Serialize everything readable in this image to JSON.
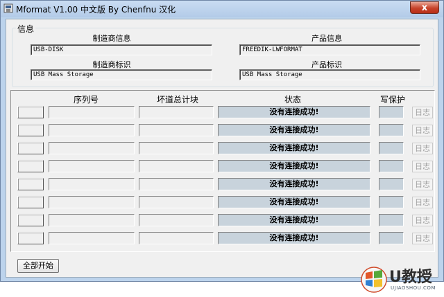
{
  "window": {
    "title": "Mformat V1.00 中文版 By Chenfnu 汉化",
    "close_label": "x"
  },
  "info": {
    "group_title": "信息",
    "manufacturer_info_label": "制造商信息",
    "manufacturer_info_value": "USB-DISK",
    "product_info_label": "产品信息",
    "product_info_value": "FREEDIK-LWFORMAT",
    "manufacturer_id_label": "制造商标识",
    "manufacturer_id_value": "USB Mass Storage",
    "product_id_label": "产品标识",
    "product_id_value": "USB Mass Storage"
  },
  "table": {
    "headers": {
      "serial": "序列号",
      "bad_blocks": "坏道总计块",
      "status": "状态",
      "write_protect": "写保护"
    },
    "rows": [
      {
        "status": "没有连接成功!",
        "log": "日志"
      },
      {
        "status": "没有连接成功!",
        "log": "日志"
      },
      {
        "status": "没有连接成功!",
        "log": "日志"
      },
      {
        "status": "没有连接成功!",
        "log": "日志"
      },
      {
        "status": "没有连接成功!",
        "log": "日志"
      },
      {
        "status": "没有连接成功!",
        "log": "日志"
      },
      {
        "status": "没有连接成功!",
        "log": "日志"
      },
      {
        "status": "没有连接成功!",
        "log": "日志"
      }
    ]
  },
  "footer": {
    "start_all_label": "全部开始"
  },
  "watermark": {
    "text": "U教授",
    "subtext": "UJIAOSHOU.COM"
  }
}
